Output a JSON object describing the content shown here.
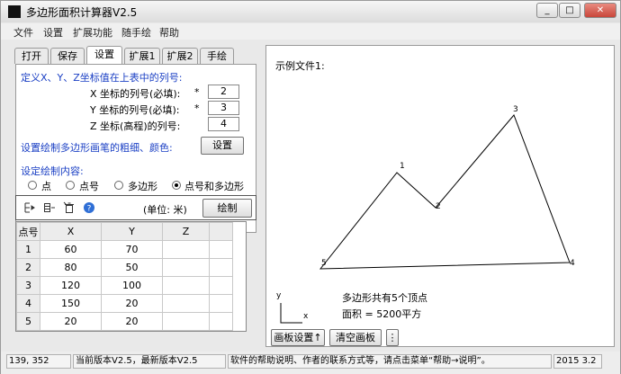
{
  "window": {
    "title": "多边形面积计算器V2.5",
    "min": "_",
    "max": "□",
    "close": "✕"
  },
  "menu": [
    "文件",
    "设置",
    "扩展功能",
    "随手绘",
    "帮助"
  ],
  "tabs": [
    "打开",
    "保存",
    "设置",
    "扩展1",
    "扩展2",
    "手绘"
  ],
  "active_tab": "设置",
  "settings": {
    "section1_title": "定义X、Y、Z坐标值在上表中的列号:",
    "x_label": "X 坐标的列号(必填):",
    "y_label": "Y 坐标的列号(必填):",
    "z_label": "Z 坐标(高程)的列号:",
    "required_mark": "*",
    "x_col": "2",
    "y_col": "3",
    "z_col": "4",
    "pen_label": "设置绘制多边形画笔的粗细、颜色:",
    "pen_button": "设置",
    "draw_content_label": "设定绘制内容:",
    "options": [
      "点",
      "点号",
      "多边形",
      "点号和多边形"
    ],
    "selected_option": 3
  },
  "toolbar": {
    "icons": [
      "insert-row-icon",
      "append-row-icon",
      "delete-row-icon",
      "help-icon"
    ],
    "unit": "(单位: 米)",
    "draw_button": "绘制"
  },
  "table": {
    "headers": [
      "点号",
      "X",
      "Y",
      "Z"
    ],
    "rows": [
      [
        "1",
        "60",
        "70",
        ""
      ],
      [
        "2",
        "80",
        "50",
        ""
      ],
      [
        "3",
        "120",
        "100",
        ""
      ],
      [
        "4",
        "150",
        "20",
        ""
      ],
      [
        "5",
        "20",
        "20",
        ""
      ]
    ]
  },
  "canvas": {
    "file_label": "示例文件1:",
    "summary": "多边形共有5个顶点",
    "area": "面积 = 5200平方",
    "axis_x": "x",
    "axis_y": "y",
    "point_labels": [
      "1",
      "2",
      "3",
      "4",
      "5"
    ],
    "board_button": "画板设置↑",
    "clear_button": "清空画板",
    "more_button": "⋮"
  },
  "status": {
    "coords": "139, 352",
    "version": "当前版本V2.5，最新版本V2.5",
    "help": "软件的帮助说明、作者的联系方式等，请点击菜单“帮助→说明”。",
    "date": "2015 3.2"
  },
  "colors": {
    "accent": "#1a3fc4",
    "panel": "#e9e9e9"
  }
}
